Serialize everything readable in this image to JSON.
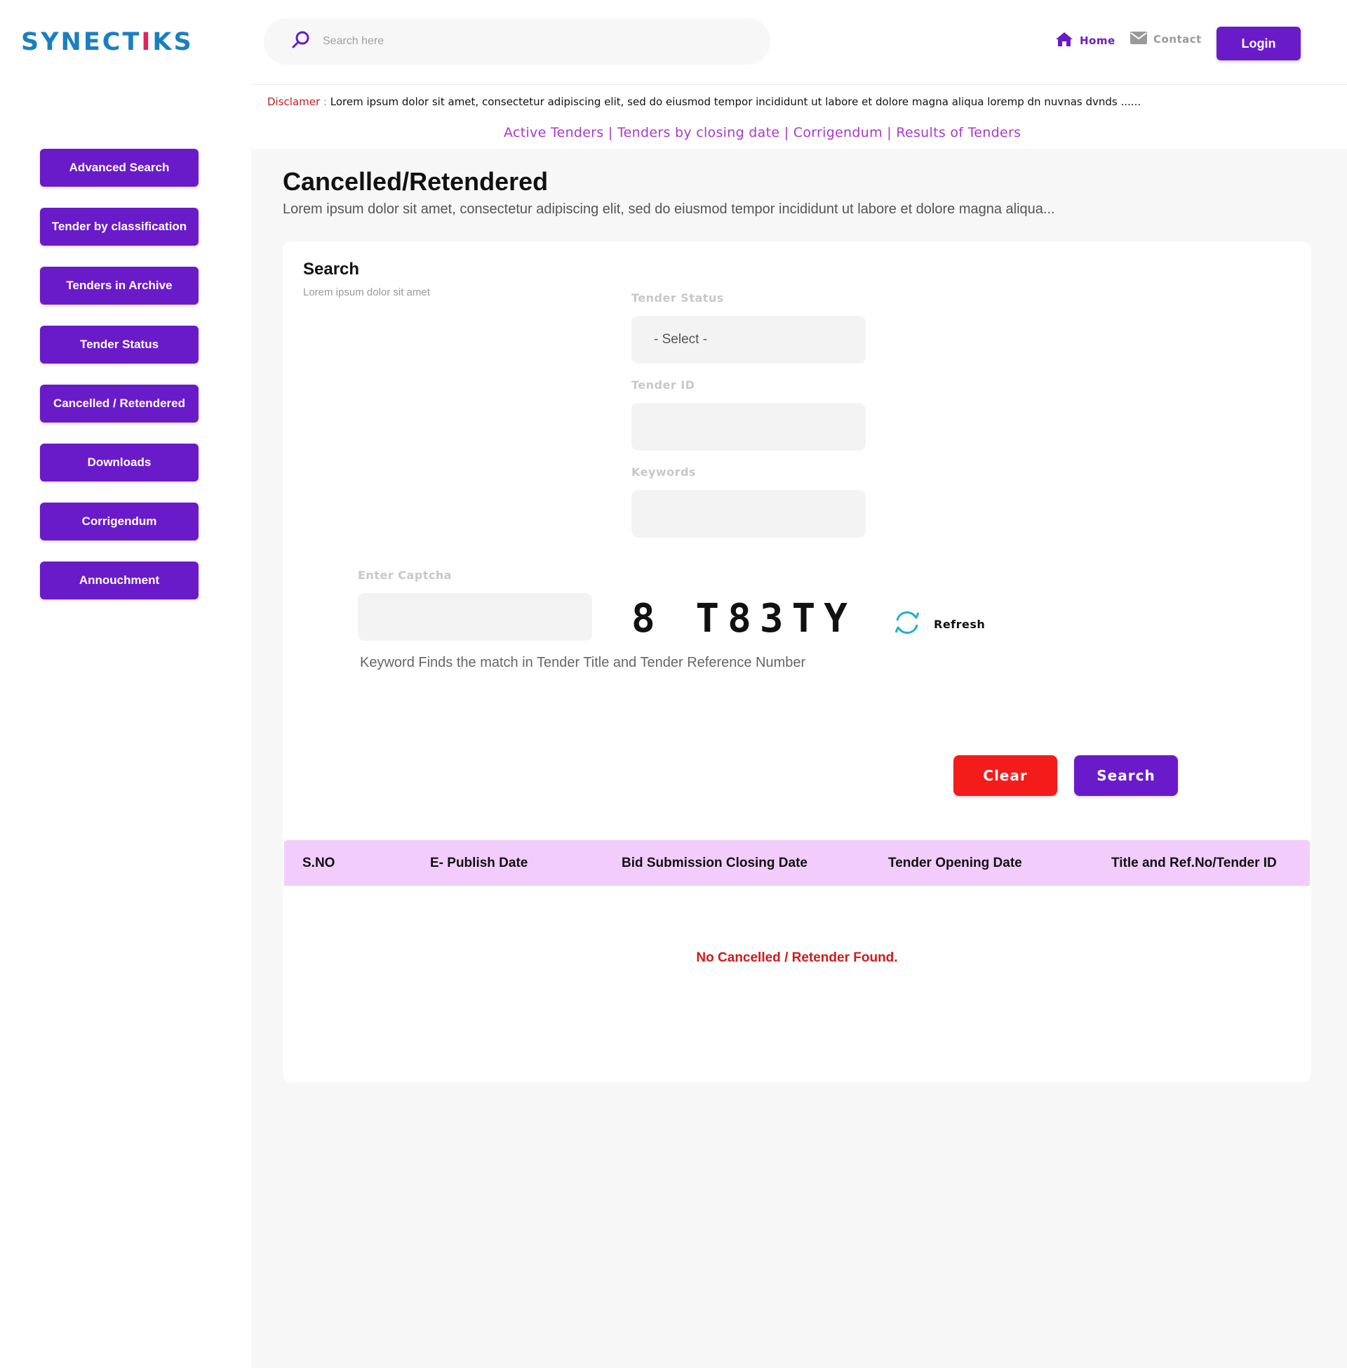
{
  "header": {
    "logo_part1": "SYNECT",
    "logo_accent": "I",
    "logo_part2": "KS",
    "search_placeholder": "Search here",
    "nav_home": "Home",
    "nav_contact": "Contact",
    "login_label": "Login"
  },
  "disclaimer": {
    "label": "Disclamer",
    "separator": ":",
    "text": "Lorem ipsum dolor sit amet, consectetur adipiscing elit, sed do eiusmod tempor incididunt ut labore et dolore magna aliqua loremp dn  nuvnas dvnds ......"
  },
  "tender_links": {
    "active": "Active Tenders",
    "sep1": " | ",
    "closing": "Tenders by closing date",
    "sep2": " | ",
    "corrigendum": "Corrigendum",
    "sep3": " | ",
    "results": "Results of Tenders"
  },
  "sidebar": {
    "items": [
      {
        "label": "Advanced Search"
      },
      {
        "label": "Tender by classification"
      },
      {
        "label": "Tenders in Archive"
      },
      {
        "label": "Tender Status"
      },
      {
        "label": "Cancelled / Retendered"
      },
      {
        "label": "Downloads"
      },
      {
        "label": "Corrigendum"
      },
      {
        "label": "Annouchment"
      }
    ]
  },
  "main": {
    "title": "Cancelled/Retendered",
    "description": "Lorem ipsum dolor sit amet, consectetur adipiscing elit, sed do eiusmod tempor incididunt ut labore et dolore magna aliqua..."
  },
  "search_card": {
    "title": "Search",
    "subtitle": "Lorem ipsum dolor sit amet",
    "tender_status_label": "Tender Status",
    "tender_status_value": "- Select -",
    "tender_id_label": "Tender ID",
    "tender_id_value": "",
    "keywords_label": "Keywords",
    "keywords_value": "",
    "captcha_label": "Enter Captcha",
    "captcha_value": "",
    "captcha_text": "8 T83TY",
    "refresh_label": "Refresh",
    "hint": "Keyword Finds the match in Tender Title and Tender Reference Number",
    "clear_label": "Clear",
    "search_label": "Search"
  },
  "table": {
    "columns": [
      "S.NO",
      "E- Publish Date",
      "Bid Submission Closing Date",
      "Tender Opening Date",
      "Title and Ref.No/Tender ID"
    ],
    "empty_message": "No Cancelled / Retender Found."
  },
  "colors": {
    "primary": "#6a1bc9",
    "danger": "#f41b1b",
    "link": "#a83ac9",
    "table_header": "#f2cdfc",
    "logo": "#1a7fc0"
  }
}
